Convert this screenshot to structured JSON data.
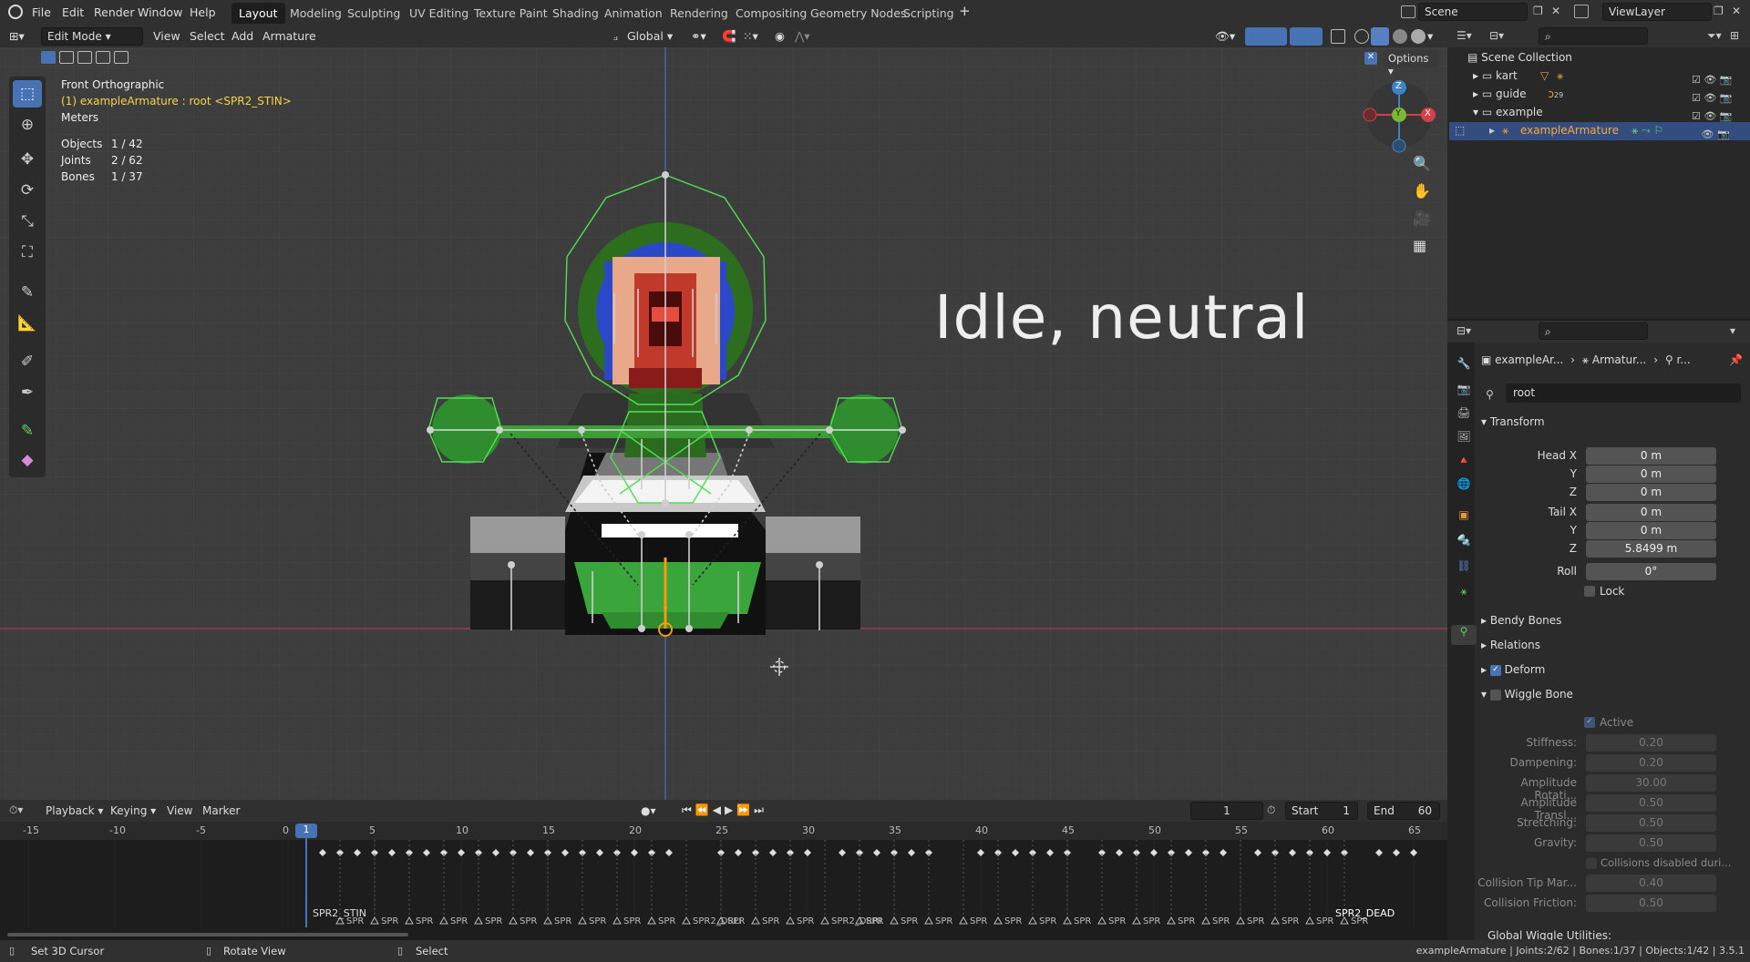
{
  "app_menu": [
    "File",
    "Edit",
    "Render",
    "Window",
    "Help"
  ],
  "workspaces": [
    "Layout",
    "Modeling",
    "Sculpting",
    "UV Editing",
    "Texture Paint",
    "Shading",
    "Animation",
    "Rendering",
    "Compositing",
    "Geometry Nodes",
    "Scripting"
  ],
  "active_workspace": "Layout",
  "scene_name": "Scene",
  "view_layer": "ViewLayer",
  "viewport_header": {
    "mode": "Edit Mode",
    "menus": [
      "View",
      "Select",
      "Add",
      "Armature"
    ],
    "transform_orientation": "Global",
    "options_label": "Options"
  },
  "overlay": {
    "view_name": "Front Orthographic",
    "context": "(1) exampleArmature : root <SPR2_STIN>",
    "units": "Meters",
    "stats": [
      {
        "label": "Objects",
        "value": "1 / 42"
      },
      {
        "label": "Joints",
        "value": "2 / 62"
      },
      {
        "label": "Bones",
        "value": "1 / 37"
      }
    ]
  },
  "viewport_caption": "Idle, neutral",
  "gizmo": {
    "z": "Z",
    "y": "Y",
    "x": "X"
  },
  "outliner": {
    "root": "Scene Collection",
    "items": [
      {
        "name": "kart",
        "selected": false
      },
      {
        "name": "guide",
        "badge": "29",
        "selected": false
      },
      {
        "name": "example",
        "selected": false
      },
      {
        "name": "exampleArmature",
        "selected": true
      }
    ]
  },
  "properties": {
    "breadcrumb": [
      "exampleAr...",
      "Armatur...",
      "r..."
    ],
    "bone_name": "root",
    "transform": {
      "title": "Transform",
      "rows": [
        {
          "label": "Head X",
          "value": "0 m"
        },
        {
          "label": "Y",
          "value": "0 m"
        },
        {
          "label": "Z",
          "value": "0 m"
        },
        {
          "label": "Tail X",
          "value": "0 m"
        },
        {
          "label": "Y",
          "value": "0 m"
        },
        {
          "label": "Z",
          "value": "5.8499 m"
        },
        {
          "label": "Roll",
          "value": "0°"
        }
      ],
      "lock_label": "Lock"
    },
    "panels": [
      "Bendy Bones",
      "Relations",
      "Deform",
      "Wiggle Bone"
    ],
    "wiggle": {
      "active_label": "Active",
      "rows": [
        {
          "label": "Stiffness:",
          "value": "0.20"
        },
        {
          "label": "Dampening:",
          "value": "0.20"
        },
        {
          "label": "Amplitude Rotati...",
          "value": "30.00"
        },
        {
          "label": "Amplitude Transl...",
          "value": "0.50"
        },
        {
          "label": "Stretching:",
          "value": "0.50"
        },
        {
          "label": "Gravity:",
          "value": "0.50"
        }
      ],
      "collisions_label": "Collisions disabled duri...",
      "rows2": [
        {
          "label": "Collision Tip Mar...",
          "value": "0.40"
        },
        {
          "label": "Collision Friction:",
          "value": "0.50"
        }
      ],
      "global_label": "Global Wiggle Utilities:"
    }
  },
  "timeline": {
    "menus": [
      "Playback",
      "Keying",
      "View",
      "Marker"
    ],
    "current_frame": "1",
    "start_label": "Start",
    "start": "1",
    "end_label": "End",
    "end": "60",
    "ruler": [
      "-15",
      "-10",
      "-5",
      "0",
      "5",
      "10",
      "15",
      "20",
      "25",
      "30",
      "35",
      "40",
      "45",
      "50",
      "55",
      "60",
      "65"
    ],
    "markers": [
      "SPR2_STIN",
      "SPR2_DRLI",
      "SPR2_DRRI",
      "SPR2_DEAD"
    ],
    "short_marker": "SPR"
  },
  "status": {
    "left": [
      {
        "icon": "mouse-left-icon",
        "text": "Set 3D Cursor"
      },
      {
        "icon": "mouse-middle-icon",
        "text": "Rotate View"
      },
      {
        "icon": "mouse-right-icon",
        "text": "Select"
      }
    ],
    "right": "exampleArmature | Joints:2/62 | Bones:1/37 | Objects:1/42 | 3.5.1"
  },
  "colors": {
    "accent": "#4772b3",
    "bone_green": "#3fc23f",
    "x_axis": "#d0414a",
    "y_axis": "#7bb833",
    "z_axis": "#3f83c6"
  }
}
